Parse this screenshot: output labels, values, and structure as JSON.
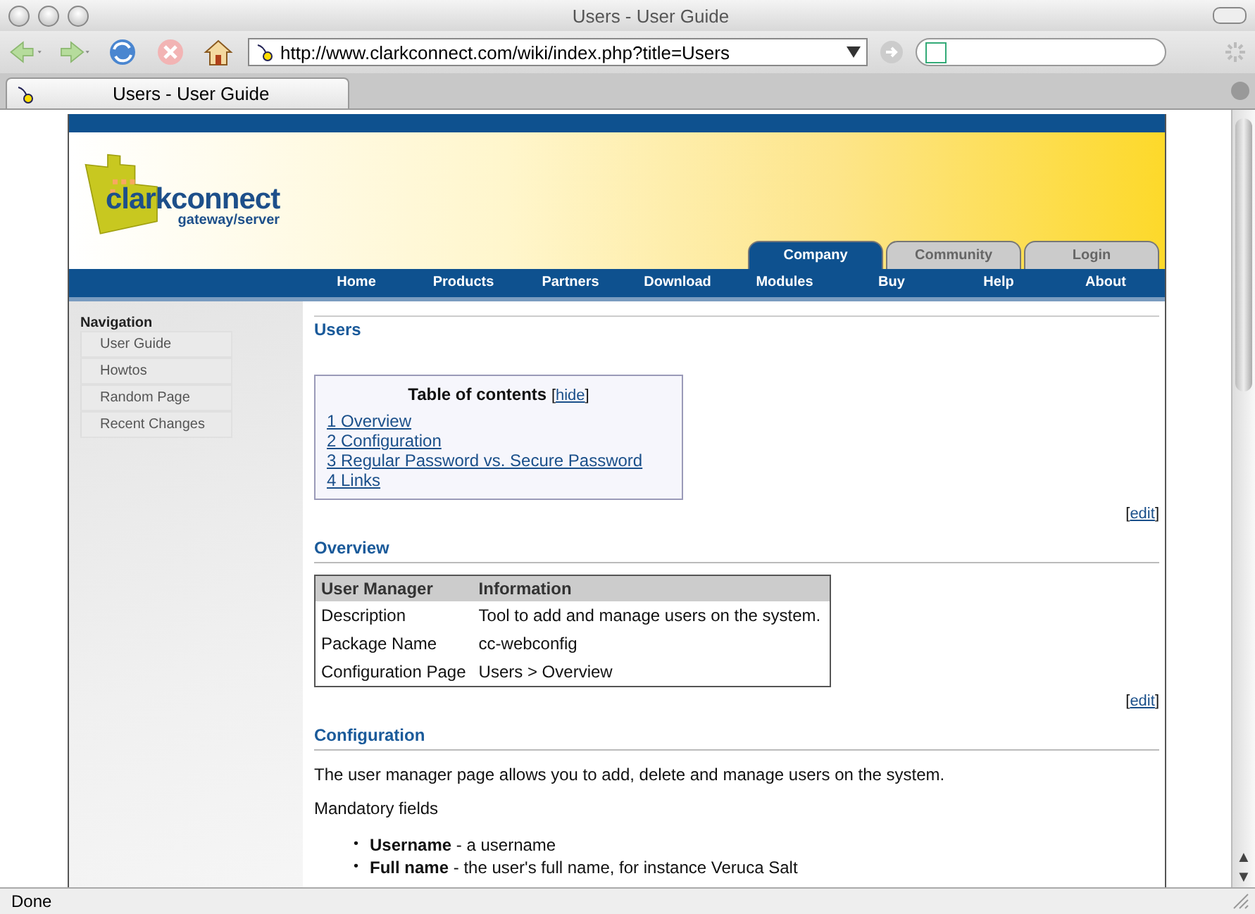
{
  "window": {
    "title": "Users - User Guide"
  },
  "toolbar": {
    "url": "http://www.clarkconnect.com/wiki/index.php?title=Users"
  },
  "tab": {
    "title": "Users - User Guide"
  },
  "site": {
    "logo_name": "clarkconnect",
    "logo_tagline": "gateway/server",
    "top_tabs": [
      {
        "label": "Company",
        "selected": true
      },
      {
        "label": "Community",
        "selected": false
      },
      {
        "label": "Login",
        "selected": false
      }
    ],
    "nav": [
      "Home",
      "Products",
      "Partners",
      "Download",
      "Modules",
      "Buy",
      "Help",
      "About"
    ]
  },
  "sidebar": {
    "heading": "Navigation",
    "items": [
      "User Guide",
      "Howtos",
      "Random Page",
      "Recent Changes"
    ]
  },
  "article": {
    "title": "Users",
    "bracket_open": "[",
    "bracket_close": "]",
    "bullet": "•",
    "toc": {
      "title": "Table of contents",
      "hide": "hide",
      "items": [
        "1 Overview",
        "2 Configuration",
        "3 Regular Password vs. Secure Password",
        "4 Links"
      ],
      "edit": "edit"
    },
    "overview": {
      "title": "Overview",
      "columns": [
        "User Manager",
        "Information"
      ],
      "rows": [
        [
          "Description",
          "Tool to add and manage users on the system."
        ],
        [
          "Package Name",
          "cc-webconfig"
        ],
        [
          "Configuration Page",
          "Users > Overview"
        ]
      ],
      "edit": "edit"
    },
    "configuration": {
      "title": "Configuration",
      "paragraphs": [
        "The user manager page allows you to add, delete and manage users on the system.",
        "Mandatory fields"
      ],
      "items": [
        "**Username** - a username",
        "**Full name** - the user's full name, for instance Veruca Salt"
      ]
    }
  },
  "scrollbar": {
    "up": "▲",
    "down": "▼"
  },
  "status_bar": {
    "text": "Done"
  }
}
